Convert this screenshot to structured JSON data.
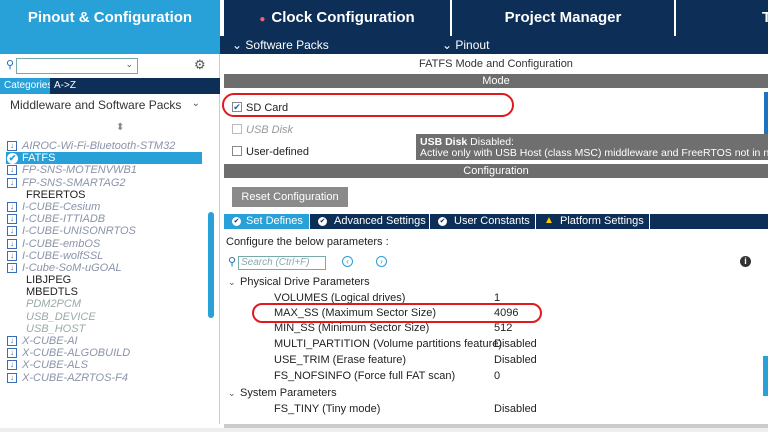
{
  "tabs": {
    "pinout_config": "Pinout & Configuration",
    "clock_config": "Clock Configuration",
    "project_manager": "Project Manager",
    "tools": "T"
  },
  "subtabs": {
    "software_packs": "Software Packs",
    "pinout": "Pinout"
  },
  "left": {
    "categories_tab": "Categories",
    "az_tab": "A->Z",
    "middleware_group": "Middleware and Software Packs",
    "items": [
      {
        "label": "AIROC-Wi-Fi-Bluetooth-STM32",
        "style": "pack"
      },
      {
        "label": "FATFS",
        "style": "selected"
      },
      {
        "label": "FP-SNS-MOTENVWB1",
        "style": "pack"
      },
      {
        "label": "FP-SNS-SMARTAG2",
        "style": "pack"
      },
      {
        "label": "FREERTOS",
        "style": "plain"
      },
      {
        "label": "I-CUBE-Cesium",
        "style": "pack"
      },
      {
        "label": "I-CUBE-ITTIADB",
        "style": "pack"
      },
      {
        "label": "I-CUBE-UNISONRTOS",
        "style": "pack"
      },
      {
        "label": "I-CUBE-embOS",
        "style": "pack"
      },
      {
        "label": "I-CUBE-wolfSSL",
        "style": "pack"
      },
      {
        "label": "I-Cube-SoM-uGOAL",
        "style": "pack"
      },
      {
        "label": "LIBJPEG",
        "style": "plain"
      },
      {
        "label": "MBEDTLS",
        "style": "plain"
      },
      {
        "label": "PDM2PCM",
        "style": "disabled"
      },
      {
        "label": "USB_DEVICE",
        "style": "disabled"
      },
      {
        "label": "USB_HOST",
        "style": "disabled"
      },
      {
        "label": "X-CUBE-AI",
        "style": "pack"
      },
      {
        "label": "X-CUBE-ALGOBUILD",
        "style": "pack"
      },
      {
        "label": "X-CUBE-ALS",
        "style": "pack"
      },
      {
        "label": "X-CUBE-AZRTOS-F4",
        "style": "pack"
      }
    ]
  },
  "main": {
    "title": "FATFS Mode and Configuration",
    "mode_header": "Mode",
    "mode_options": {
      "sd_card": "SD Card",
      "usb_disk": "USB Disk",
      "user_defined": "User-defined"
    },
    "tooltip_title": "USB Disk",
    "tooltip_title_suffix": " Disabled:",
    "tooltip_body": "Active only with USB Host (class MSC) middleware and FreeRTOS not in na",
    "config_header": "Configuration",
    "reset_button": "Reset Configuration",
    "settings_tabs": {
      "set_defines": "Set Defines",
      "advanced": "Advanced Settings",
      "user_constants": "User Constants",
      "platform": "Platform Settings"
    },
    "configure_text": "Configure the below parameters :",
    "search_placeholder": "Search (Ctrl+F)",
    "groups": {
      "physical": "Physical Drive Parameters",
      "system": "System Parameters"
    },
    "params": [
      {
        "name": "VOLUMES (Logical drives)",
        "value": "1"
      },
      {
        "name": "MAX_SS (Maximum Sector Size)",
        "value": "4096"
      },
      {
        "name": "MIN_SS (Minimum Sector Size)",
        "value": "512"
      },
      {
        "name": "MULTI_PARTITION (Volume partitions feature)",
        "value": "Disabled"
      },
      {
        "name": "USE_TRIM (Erase feature)",
        "value": "Disabled"
      },
      {
        "name": "FS_NOFSINFO (Force full FAT scan)",
        "value": "0"
      }
    ],
    "system_params": [
      {
        "name": "FS_TINY (Tiny mode)",
        "value": "Disabled"
      }
    ]
  },
  "colors": {
    "accent": "#28a0d8",
    "navy": "#0d2e57",
    "annotation": "#e0191f"
  }
}
